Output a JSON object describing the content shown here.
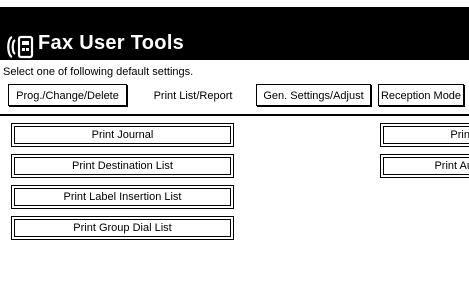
{
  "window": {
    "title": "Fax User Tools",
    "instruction": "Select one of following default settings."
  },
  "tabs": [
    {
      "label": "Prog./Change/Delete",
      "selected": false
    },
    {
      "label": "Print List/Report",
      "selected": true
    },
    {
      "label": "Gen. Settings/Adjust",
      "selected": false
    },
    {
      "label": "Reception Mode",
      "selected": false
    }
  ],
  "buttons_left": [
    {
      "label": "Print Journal"
    },
    {
      "label": "Print Destination List"
    },
    {
      "label": "Print Label Insertion List"
    },
    {
      "label": "Print Group Dial List"
    }
  ],
  "buttons_right": [
    {
      "label": "Print"
    },
    {
      "label": "Print Au"
    }
  ],
  "icons": {
    "title_icon": "fax-tools-icon"
  }
}
